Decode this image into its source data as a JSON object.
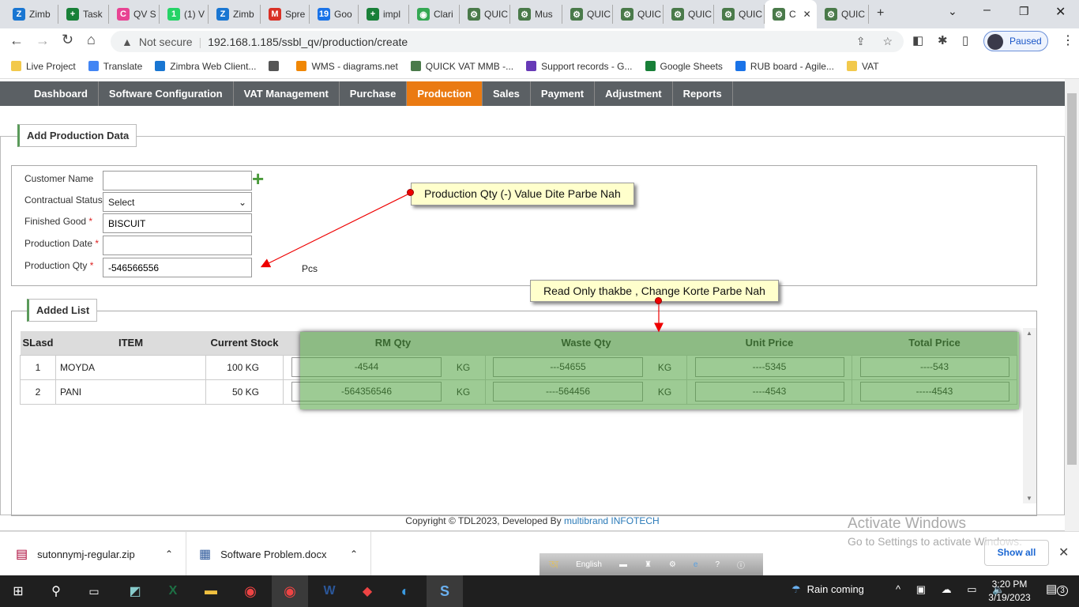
{
  "browser": {
    "tabs": [
      {
        "label": "Zimb",
        "icon": "zimbra-icon",
        "color": "#1976d2",
        "glyph": "Z"
      },
      {
        "label": "Task",
        "icon": "sheets-icon",
        "color": "#188038",
        "glyph": "+"
      },
      {
        "label": "QV S",
        "icon": "clickup-icon",
        "color": "#e84393",
        "glyph": "C"
      },
      {
        "label": "(1) V",
        "icon": "whatsapp-icon",
        "color": "#25d366",
        "glyph": "1"
      },
      {
        "label": "Zimb",
        "icon": "zimbra-icon",
        "color": "#1976d2",
        "glyph": "Z"
      },
      {
        "label": "Spre",
        "icon": "gmail-icon",
        "color": "#d93025",
        "glyph": "M"
      },
      {
        "label": "Goo",
        "icon": "calendar-icon",
        "color": "#1a73e8",
        "glyph": "19"
      },
      {
        "label": "impl",
        "icon": "sheets-icon",
        "color": "#188038",
        "glyph": "+"
      },
      {
        "label": "Clari",
        "icon": "maps-icon",
        "color": "#34a853",
        "glyph": "◉"
      },
      {
        "label": "QUIC",
        "icon": "gear-icon",
        "color": "#4a7a4a",
        "glyph": "⚙"
      },
      {
        "label": "Mus",
        "icon": "gear-icon",
        "color": "#4a7a4a",
        "glyph": "⚙"
      },
      {
        "label": "QUIC",
        "icon": "gear-icon",
        "color": "#4a7a4a",
        "glyph": "⚙"
      },
      {
        "label": "QUIC",
        "icon": "gear-icon",
        "color": "#4a7a4a",
        "glyph": "⚙"
      },
      {
        "label": "QUIC",
        "icon": "gear-icon",
        "color": "#4a7a4a",
        "glyph": "⚙"
      },
      {
        "label": "QUIC",
        "icon": "gear-icon",
        "color": "#4a7a4a",
        "glyph": "⚙"
      },
      {
        "label": "C",
        "icon": "gear-icon",
        "color": "#4a7a4a",
        "glyph": "⚙",
        "active": true
      },
      {
        "label": "QUIC",
        "icon": "gear-icon",
        "color": "#4a7a4a",
        "glyph": "⚙"
      }
    ],
    "not_secure": "Not secure",
    "url": "192.168.1.185/ssbl_qv/production/create",
    "profile": "Paused",
    "bookmarks": [
      {
        "label": "Live Project",
        "color": "#f2c94c"
      },
      {
        "label": "Translate",
        "color": "#4285f4"
      },
      {
        "label": "Zimbra Web Client...",
        "color": "#1976d2"
      },
      {
        "label": "",
        "color": "#555"
      },
      {
        "label": "WMS - diagrams.net",
        "color": "#f08705"
      },
      {
        "label": "QUICK VAT MMB -...",
        "color": "#4a7a4a"
      },
      {
        "label": "Support records - G...",
        "color": "#673ab7"
      },
      {
        "label": "Google Sheets",
        "color": "#188038"
      },
      {
        "label": "RUB board - Agile...",
        "color": "#1a73e8"
      },
      {
        "label": "VAT",
        "color": "#f2c94c"
      }
    ]
  },
  "nav": {
    "items": [
      "Dashboard",
      "Software Configuration",
      "VAT Management",
      "Purchase",
      "Production",
      "Sales",
      "Payment",
      "Adjustment",
      "Reports"
    ],
    "active": "Production",
    "accent": "#ea7a12"
  },
  "form": {
    "legend": "Add Production Data",
    "customer_name_label": "Customer Name",
    "customer_name": "",
    "contractual_status_label": "Contractual Status",
    "contractual_status": "Select",
    "finished_good_label": "Finished Good",
    "finished_good": "BISCUIT",
    "production_date_label": "Production Date",
    "production_date": "",
    "production_qty_label": "Production Qty",
    "production_qty": "-546566556",
    "unit": "Pcs",
    "required": "*"
  },
  "annotations": {
    "qty_note": "Production Qty (-) Value Dite Parbe Nah",
    "readonly_note": "Read Only thakbe , Change Korte Parbe Nah"
  },
  "list": {
    "legend": "Added List",
    "headers": [
      "SLasd",
      "ITEM",
      "Current Stock",
      "RM Qty",
      "Waste Qty",
      "Unit Price",
      "Total Price"
    ],
    "rows": [
      {
        "sl": "1",
        "item": "MOYDA",
        "stock": "100 KG",
        "rm_qty": "-4544",
        "rm_unit": "KG",
        "waste_qty": "---54655",
        "waste_unit": "KG",
        "unit_price": "----5345",
        "total_price": "----543"
      },
      {
        "sl": "2",
        "item": "PANI",
        "stock": "50 KG",
        "rm_qty": "-564356546",
        "rm_unit": "KG",
        "waste_qty": "----564456",
        "waste_unit": "KG",
        "unit_price": "----4543",
        "total_price": "-----4543"
      }
    ]
  },
  "footer": {
    "copyright": "Copyright © TDL2023, Developed By ",
    "developer": "multibrand INFOTECH"
  },
  "watermark": {
    "title": "Activate Windows",
    "subtitle": "Go to Settings to activate Windows."
  },
  "downloads": {
    "items": [
      "sutonnymj-regular.zip",
      "Software Problem.docx"
    ],
    "show_all": "Show all"
  },
  "ime": {
    "language": "English"
  },
  "taskbar": {
    "weather": "Rain coming",
    "time": "3:20 PM",
    "date": "3/19/2023",
    "notifications": "3"
  }
}
